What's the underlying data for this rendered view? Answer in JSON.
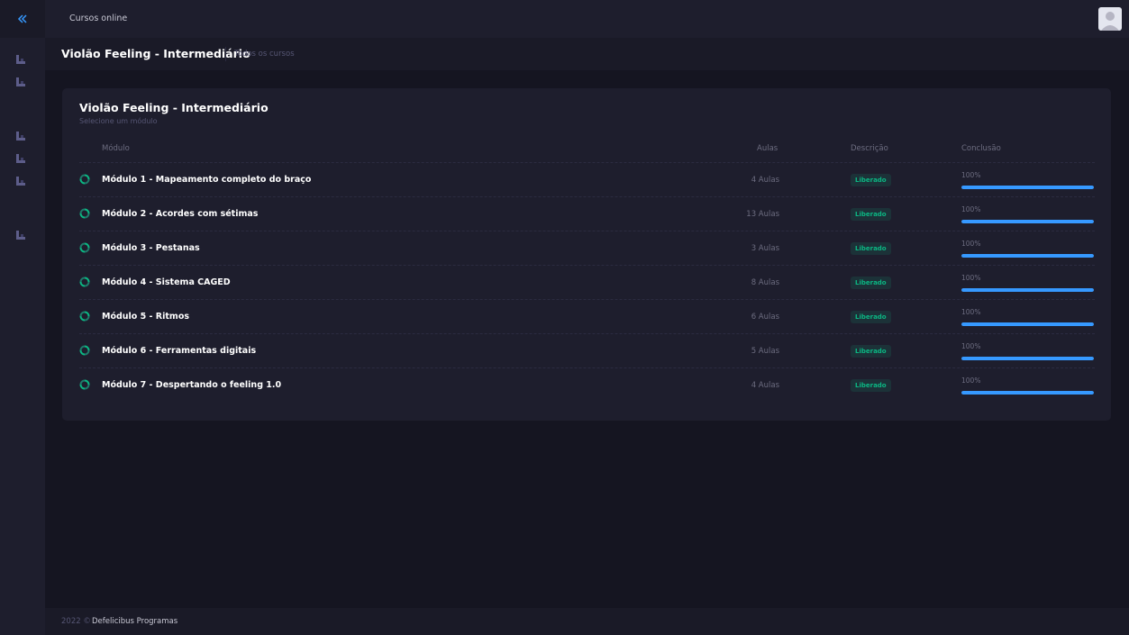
{
  "topbar": {
    "title": "Cursos online"
  },
  "subheader": {
    "title": "Violão Feeling - Intermediário",
    "link": "Todos os cursos"
  },
  "card": {
    "title": "Violão Feeling - Intermediário",
    "subtitle": "Selecione um módulo",
    "headers": {
      "modulo": "Módulo",
      "aulas": "Aulas",
      "descricao": "Descrição",
      "conclusao": "Conclusão"
    },
    "rows": [
      {
        "name": "Módulo 1 - Mapeamento completo do braço",
        "aulas": "4 Aulas",
        "status": "Liberado",
        "pct": "100%",
        "progress": 1.0
      },
      {
        "name": "Módulo 2 - Acordes com sétimas",
        "aulas": "13 Aulas",
        "status": "Liberado",
        "pct": "100%",
        "progress": 1.0
      },
      {
        "name": "Módulo 3 - Pestanas",
        "aulas": "3 Aulas",
        "status": "Liberado",
        "pct": "100%",
        "progress": 1.0
      },
      {
        "name": "Módulo 4 - Sistema CAGED",
        "aulas": "8 Aulas",
        "status": "Liberado",
        "pct": "100%",
        "progress": 1.0
      },
      {
        "name": "Módulo 5 - Ritmos",
        "aulas": "6 Aulas",
        "status": "Liberado",
        "pct": "100%",
        "progress": 1.0
      },
      {
        "name": "Módulo 6 - Ferramentas digitais",
        "aulas": "5 Aulas",
        "status": "Liberado",
        "pct": "100%",
        "progress": 1.0
      },
      {
        "name": "Módulo 7 - Despertando o feeling 1.0",
        "aulas": "4 Aulas",
        "status": "Liberado",
        "pct": "100%",
        "progress": 1.0
      }
    ]
  },
  "footer": {
    "year": "2022 ©",
    "name": "Defelicibus Programas"
  },
  "icons": {
    "collapse": "double-chevron-left-icon",
    "sidebar_items": "chart-icon",
    "module": "sync-icon",
    "avatar": "user-avatar"
  },
  "colors": {
    "accent": "#3699ff",
    "success": "#0bb783",
    "background": "#151521",
    "panel": "#1e1e2d"
  }
}
